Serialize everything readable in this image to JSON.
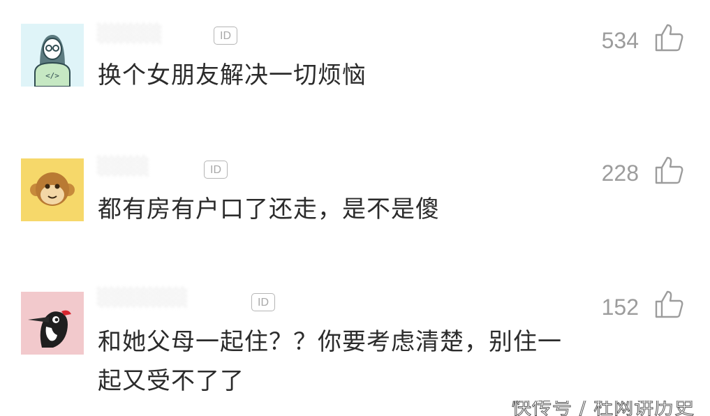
{
  "comments": [
    {
      "avatar": "coder-avatar-icon",
      "username": "░░░░░",
      "id_badge": "ID",
      "text_lines": [
        "换个女朋友解决一切烦恼"
      ],
      "likes": "534"
    },
    {
      "avatar": "monkey-avatar-icon",
      "username": "░░░░",
      "id_badge": "ID",
      "text_lines": [
        "都有房有户口了还走，是不是傻"
      ],
      "likes": "228"
    },
    {
      "avatar": "woodpecker-avatar-icon",
      "username": "░░░░░░░",
      "id_badge": "ID",
      "text_lines": [
        "和她父母一起住？？你要考虑清楚，别住一",
        "起又受不了了"
      ],
      "likes": "152"
    }
  ],
  "watermark": "快传号 / 杜网讲历史",
  "colors": {
    "text": "#2b2b2b",
    "muted": "#9c9c9c",
    "avatar1_bg": "#dff4f8",
    "avatar2_bg": "#f6d86a",
    "avatar3_bg": "#f2c9cc"
  }
}
